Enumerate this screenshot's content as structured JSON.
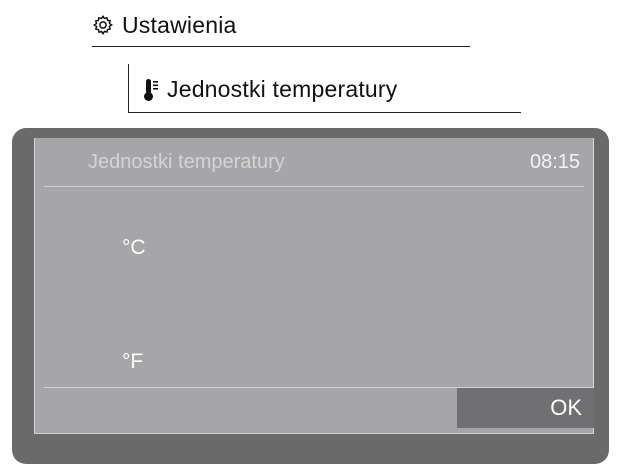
{
  "breadcrumb": {
    "level1": {
      "icon": "gear-icon",
      "label": "Ustawienia"
    },
    "level2": {
      "icon": "thermometer-icon",
      "label": "Jednostki temperatury"
    }
  },
  "screen": {
    "title": "Jednostki temperatury",
    "time": "08:15",
    "options": [
      "°C",
      "°F"
    ],
    "ok_label": "OK"
  }
}
